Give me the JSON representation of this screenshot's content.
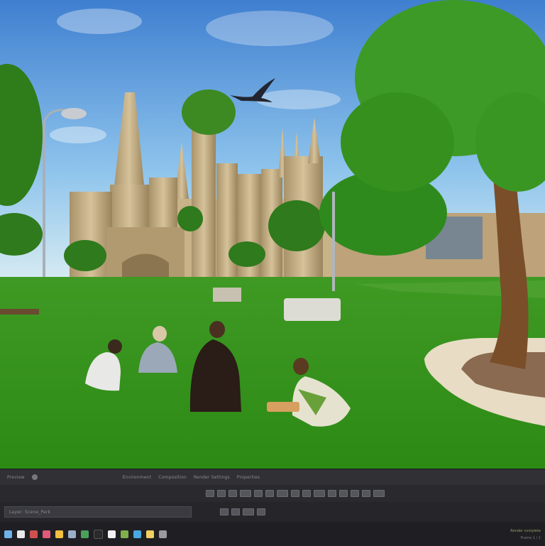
{
  "window": {
    "panel_labels": [
      "Preview",
      "Environment",
      "Composition",
      "Render Settings",
      "Properties"
    ],
    "layer_label": "Layer: Scene_Park",
    "status_text": "Render complete",
    "status_detail": "Frame 1 / 1"
  },
  "toolbar": {
    "icons": [
      "move-icon",
      "rotate-icon",
      "scale-icon",
      "camera-icon",
      "light-icon",
      "mesh-icon",
      "material-icon",
      "terrain-icon",
      "tree-icon",
      "render-icon",
      "grid-icon",
      "snap-icon",
      "undo-icon",
      "redo-icon",
      "settings-icon"
    ]
  },
  "dock": {
    "icons": [
      {
        "name": "finder-icon",
        "color": "#6fb3e8"
      },
      {
        "name": "browser-icon",
        "color": "#e8e8e8"
      },
      {
        "name": "mail-icon",
        "color": "#d05050"
      },
      {
        "name": "music-icon",
        "color": "#e05a7a"
      },
      {
        "name": "photos-icon",
        "color": "#f0c040"
      },
      {
        "name": "folder-icon",
        "color": "#9ab0c8"
      },
      {
        "name": "editor-icon",
        "color": "#4aa05a"
      },
      {
        "name": "terminal-icon",
        "color": "#2a2a2a"
      },
      {
        "name": "calendar-icon",
        "color": "#f2f2f2"
      },
      {
        "name": "render-app-icon",
        "color": "#7fb04a"
      },
      {
        "name": "chat-icon",
        "color": "#48a8e0"
      },
      {
        "name": "notes-icon",
        "color": "#f0d060"
      },
      {
        "name": "trash-icon",
        "color": "#9a9aa0"
      }
    ]
  }
}
